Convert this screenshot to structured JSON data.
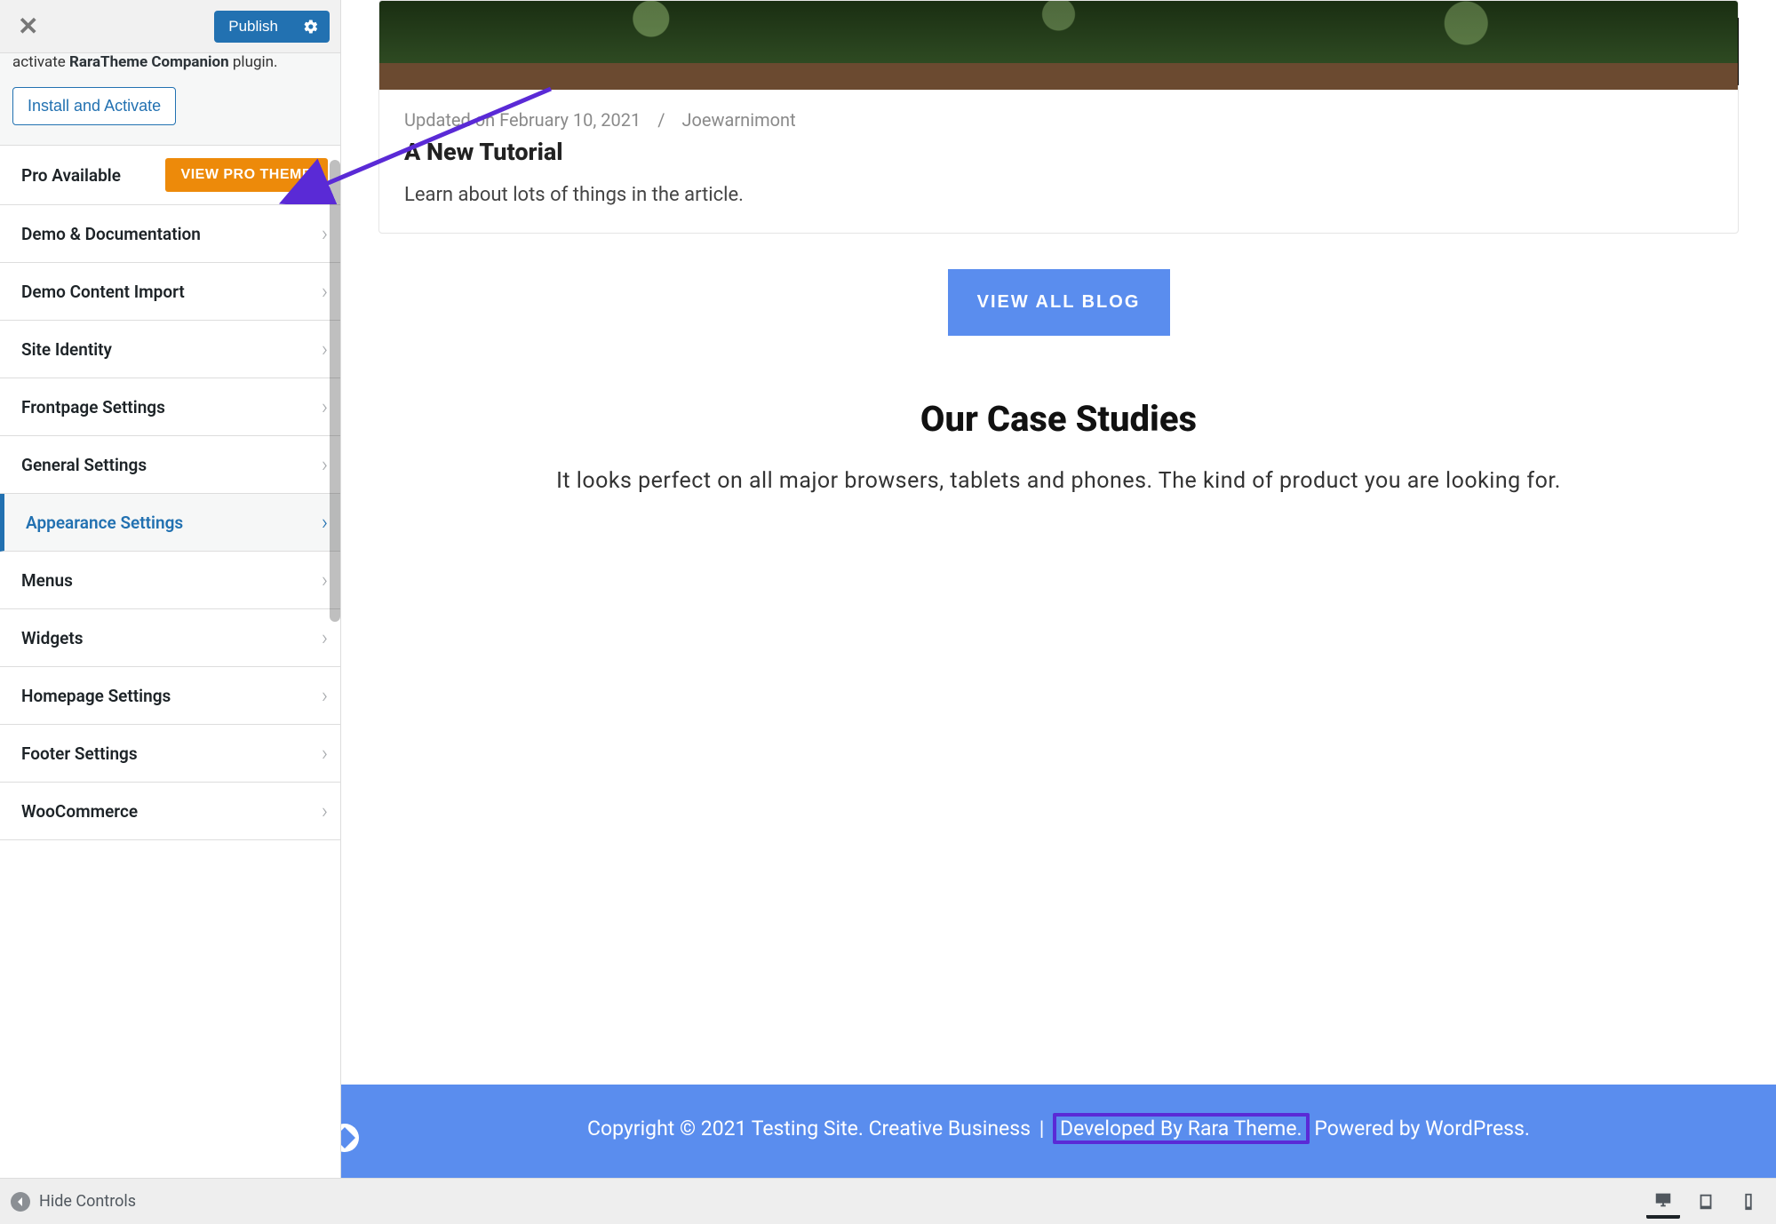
{
  "topbar": {
    "publish_label": "Publish"
  },
  "notice": {
    "prefix": "activate ",
    "bold": "RaraTheme Companion",
    "suffix": " plugin.",
    "install_label": "Install and Activate"
  },
  "pro": {
    "label": "Pro Available",
    "button": "VIEW PRO THEME"
  },
  "menu": [
    {
      "label": "Demo & Documentation",
      "active": false
    },
    {
      "label": "Demo Content Import",
      "active": false
    },
    {
      "label": "Site Identity",
      "active": false
    },
    {
      "label": "Frontpage Settings",
      "active": false
    },
    {
      "label": "General Settings",
      "active": false
    },
    {
      "label": "Appearance Settings",
      "active": true
    },
    {
      "label": "Menus",
      "active": false
    },
    {
      "label": "Widgets",
      "active": false
    },
    {
      "label": "Homepage Settings",
      "active": false
    },
    {
      "label": "Footer Settings",
      "active": false
    },
    {
      "label": "WooCommerce",
      "active": false
    }
  ],
  "bottombar": {
    "hide_label": "Hide Controls"
  },
  "post": {
    "meta_date": "Updated on February 10, 2021",
    "meta_author": "Joewarnimont",
    "title": "A New Tutorial",
    "excerpt": "Learn about lots of things in the article."
  },
  "view_all_label": "VIEW ALL BLOG",
  "case": {
    "title": "Our Case Studies",
    "subtitle": "It looks perfect on all major browsers, tablets and phones. The kind of product you are looking for."
  },
  "footer": {
    "copyright": "Copyright © 2021 Testing Site. Creative Business ",
    "pipe": "|",
    "developed": " Developed By Rara Theme.",
    "powered": " Powered by WordPress."
  }
}
